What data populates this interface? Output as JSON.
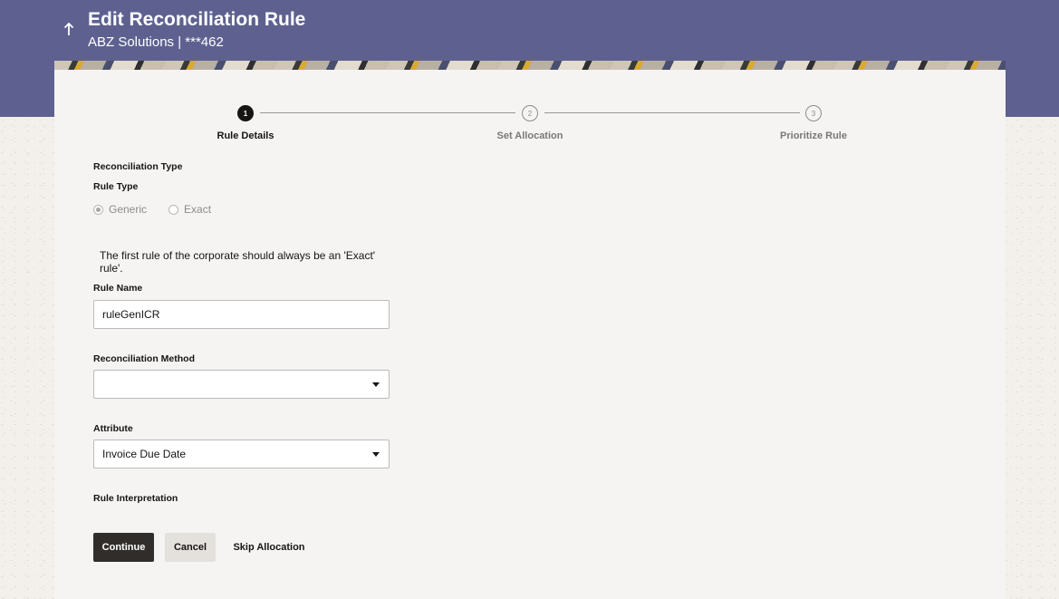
{
  "header": {
    "title": "Edit Reconciliation Rule",
    "subtitle": "ABZ Solutions | ***462",
    "back_icon": "up-arrow-icon"
  },
  "stepper": {
    "steps": [
      {
        "number": "1",
        "label": "Rule Details",
        "state": "active"
      },
      {
        "number": "2",
        "label": "Set Allocation",
        "state": "inactive"
      },
      {
        "number": "3",
        "label": "Prioritize Rule",
        "state": "inactive"
      }
    ]
  },
  "form": {
    "reconciliation_type_label": "Reconciliation Type",
    "rule_type_label": "Rule Type",
    "rule_type_options": [
      {
        "label": "Generic",
        "selected": true
      },
      {
        "label": "Exact",
        "selected": false
      }
    ],
    "info_message": "The first rule of the corporate should always be an 'Exact' rule'.",
    "rule_name_label": "Rule Name",
    "rule_name_value": "ruleGenICR",
    "reconciliation_method_label": "Reconciliation Method",
    "reconciliation_method_value": "",
    "attribute_label": "Attribute",
    "attribute_value": "Invoice Due Date",
    "rule_interpretation_label": "Rule Interpretation"
  },
  "actions": {
    "continue_label": "Continue",
    "cancel_label": "Cancel",
    "skip_label": "Skip Allocation"
  },
  "colors": {
    "header_bg": "#5e6190",
    "primary_button": "#312d2a",
    "secondary_button": "#e4e1dd"
  }
}
